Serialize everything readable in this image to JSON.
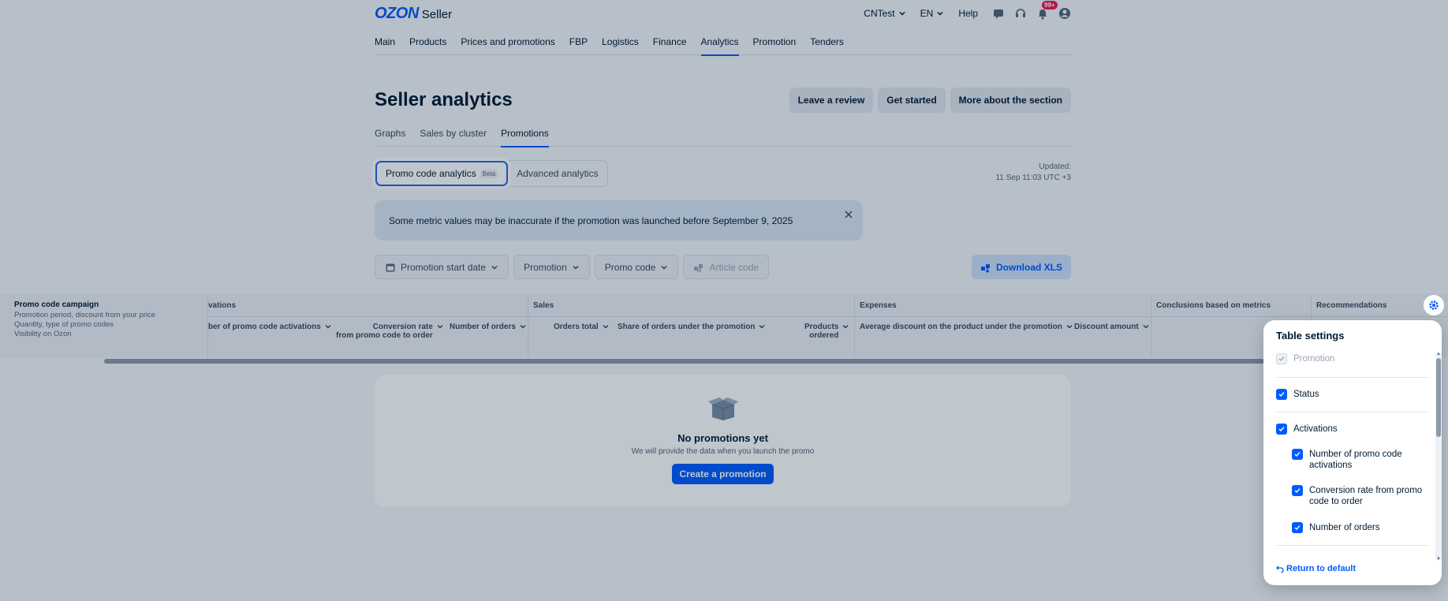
{
  "header": {
    "logo_brand": "OZON",
    "logo_sub": "Seller",
    "account": "CNTest",
    "language": "EN",
    "help": "Help",
    "notifications_badge": "99+"
  },
  "main_nav": [
    "Main",
    "Products",
    "Prices and promotions",
    "FBP",
    "Logistics",
    "Finance",
    "Analytics",
    "Promotion",
    "Tenders"
  ],
  "main_nav_active": "Analytics",
  "page": {
    "title": "Seller analytics",
    "buttons": {
      "review": "Leave a review",
      "start": "Get started",
      "about": "More about the section"
    }
  },
  "subtabs": [
    "Graphs",
    "Sales by cluster",
    "Promotions"
  ],
  "subtab_active": "Promotions",
  "segment": {
    "promo": "Promo code analytics",
    "beta": "Beta",
    "advanced": "Advanced analytics"
  },
  "updated": {
    "label": "Updated:",
    "time": "11 Sep 11:03 UTC +3"
  },
  "alert": {
    "text": "Some metric values may be inaccurate if the promotion was launched before September 9, 2025"
  },
  "filters": {
    "start_date": "Promotion start date",
    "promotion": "Promotion",
    "promo_code": "Promo code",
    "article": "Article code",
    "download": "Download XLS"
  },
  "table": {
    "left_title": "Promo code campaign",
    "left_lines": [
      "Promotion period, discount from your price",
      "Quantity, type of promo codes",
      "Visibility on Ozon"
    ],
    "groups": {
      "activations": "vations",
      "sales": "Sales",
      "expenses": "Expenses",
      "conclusions": "Conclusions based on metrics",
      "recommendations": "Recommendations"
    },
    "columns": {
      "num_activations": "ber of promo code activations",
      "conv_rate_1": "Conversion rate",
      "conv_rate_2": "from promo code to order",
      "num_orders": "Number of orders",
      "orders_total": "Orders total",
      "share_orders": "Share of orders under the promotion",
      "products_1": "Products",
      "products_2": "ordered",
      "avg_discount": "Average discount on the product under the promotion",
      "discount_amount": "Discount amount"
    }
  },
  "empty": {
    "title": "No promotions yet",
    "desc": "We will provide the data when you launch the promo",
    "button": "Create a promotion"
  },
  "settings": {
    "title": "Table settings",
    "items": {
      "promotion": "Promotion",
      "status": "Status",
      "activations": "Activations",
      "num_activations": "Number of promo code activations",
      "conv_rate": "Conversion rate from promo code to order",
      "num_orders": "Number of orders"
    },
    "reset": "Return to default"
  },
  "colors": {
    "accent": "#005bff",
    "badge": "#f91155"
  }
}
